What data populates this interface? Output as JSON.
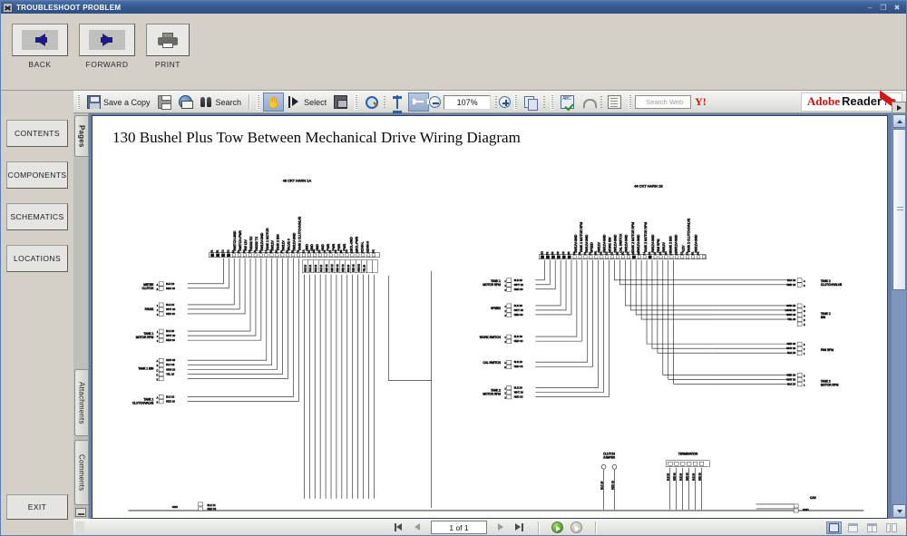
{
  "window": {
    "title": "TROUBLESHOOT PROBLEM",
    "app_icon": "scissors-icon",
    "buttons": {
      "minimize": "–",
      "maximize": "❐",
      "close": "✖"
    }
  },
  "nav_toolbar": {
    "items": [
      {
        "label": "BACK",
        "icon": "arrow-left-icon"
      },
      {
        "label": "FORWARD",
        "icon": "arrow-right-icon"
      },
      {
        "label": "PRINT",
        "icon": "printer-icon"
      }
    ]
  },
  "sidebar": {
    "items": [
      {
        "label": "CONTENTS"
      },
      {
        "label": "COMPONENTS"
      },
      {
        "label": "SCHEMATICS"
      },
      {
        "label": "LOCATIONS"
      }
    ],
    "exit_label": "EXIT"
  },
  "acrobat_toolbar": {
    "save_label": "Save a Copy",
    "search_label": "Search",
    "select_label": "Select",
    "zoom_value": "107%",
    "search_web_placeholder": "Search Web",
    "yahoo_label": "Y!",
    "brand": {
      "part1": "Adobe",
      "part2": "Reader",
      "part3": "7.0"
    },
    "icons": [
      "save-icon",
      "print-icon",
      "email-icon",
      "search-icon",
      "hand-tool-icon",
      "select-tool-icon",
      "snapshot-icon",
      "zoom-in-tool-icon",
      "fit-height-icon",
      "fit-width-icon",
      "zoom-out-icon",
      "zoom-in-icon",
      "organize-pages-icon",
      "spell-check-icon",
      "undo-icon",
      "document-icon",
      "yahoo-icon"
    ]
  },
  "nav_tabs": {
    "tabs": [
      {
        "label": "Pages",
        "active": true
      },
      {
        "label": "Attachments",
        "active": false
      },
      {
        "label": "Comments",
        "active": false
      }
    ]
  },
  "document": {
    "title": "130 Bushel Plus Tow Between Mechanical Drive Wiring Diagram",
    "diagram": {
      "headers": [
        "48 CKT HARN 1A",
        "48 CKT HARN 1B"
      ],
      "left_connectors": [
        "METER CLUTCH",
        "RS232",
        "TANK 1 MOTOR RPM",
        "TANK 1 BIN",
        "TANK 1 CLUTCH/VALVE"
      ],
      "mid_connectors": [
        "TANK 1 MOTOR RPM",
        "SPEED",
        "WORK SWITCH",
        "CAL SWITCH",
        "TANK 2 MOTOR RPM"
      ],
      "right_connectors": [
        "TANK 2 CLUTCH/VALVE",
        "TANK 2 BIN",
        "FAN RPM",
        "TANK 2 MOTOR RPM"
      ],
      "bottom_labels": [
        "CLUTCH JUMPER",
        "TERMINATION",
        "CAN",
        "GND"
      ],
      "pin_labels_a": [
        "SWITCH-GND",
        "SWITCH-PWR",
        "SW 12V",
        "RS232 RX",
        "RS232 TX",
        "SW12V-GND",
        "TANK 1 MOTOR",
        "SW12V",
        "TANK 2 BIN",
        "SW12V",
        "VALVE 0",
        "SW12V-GND",
        "TANK 1 CLUTCH/VALVE",
        "GND",
        "GND",
        "GND",
        "GND",
        "PWR",
        "PWR",
        "PWR",
        "PWR",
        "SOL-GND",
        "SOL-PWR",
        "CAN-L",
        "CAN-H"
      ],
      "pin_labels_b": [
        "SW12V-GND",
        "TANK 1 MOTOR RPM",
        "SW12V-GND",
        "SPEED",
        "SW12V",
        "WORK SW",
        "SW12V-GND",
        "CAL SWITCH",
        "SW12V-GND",
        "TANK 2 MOTOR RPM",
        "SW12V-GND",
        "TANK 2 MOTOR RPM",
        "SW12V-GND",
        "FAN RPM",
        "SW12V",
        "TANK 2 BIN",
        "SW12V-GND",
        "+12V",
        "TANK 2 CLUTCH/VALVE",
        "SW12V-GND"
      ],
      "wire_labels": [
        "BLK 18",
        "RED 18",
        "BLK 20",
        "WHT 20",
        "RED 20",
        "GRN 18",
        "YEL 18",
        "BLK 16",
        "RED 16",
        "BLK 20",
        "RED 20",
        "BLU 18",
        "ORN 18"
      ]
    }
  },
  "status_bar": {
    "page_indicator": "1 of 1",
    "icons": [
      "first-page-icon",
      "previous-page-icon",
      "next-page-icon",
      "last-page-icon",
      "previous-view-icon",
      "next-view-icon"
    ],
    "view_modes": [
      "single-page-view",
      "continuous-view",
      "continuous-facing-view",
      "facing-view"
    ]
  },
  "colors": {
    "titlebar": "#36598e",
    "chrome": "#d4d0c8",
    "viewport": "#6a7fa8",
    "accent": "#2f5fa0",
    "brand_red": "#cc1111"
  }
}
